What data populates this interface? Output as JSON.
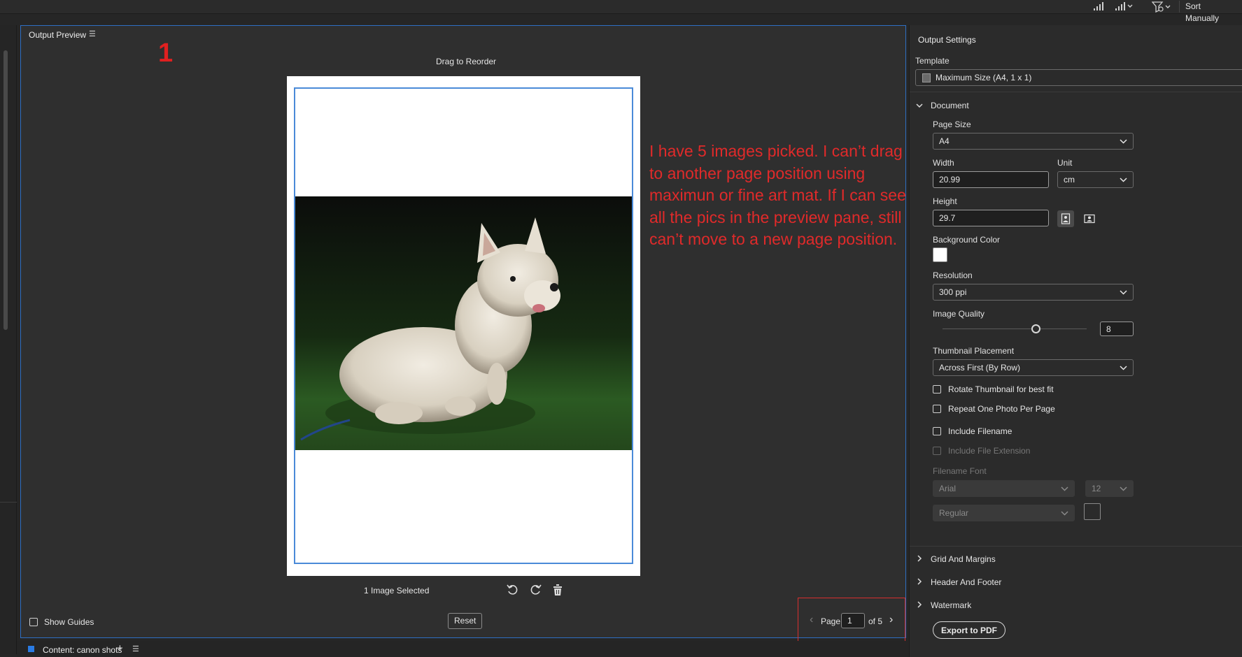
{
  "toolbar": {
    "sort_label": "Sort Manually",
    "icons": [
      "sort-ascending-icon",
      "sort-descending-icon",
      "filter-icon"
    ]
  },
  "preview": {
    "title": "Output Preview",
    "annotation_number": "1",
    "drag_label": "Drag to Reorder",
    "annotation_text": "I have 5 images picked. I can’t drag to another page position using maximun or fine art mat. If I can see all the pics in the preview pane, still can’t move to a new page position.",
    "selection_label": "1 Image Selected",
    "show_guides_label": "Show Guides",
    "reset_label": "Reset",
    "pager": {
      "page_label": "Page",
      "current_page": "1",
      "of_label": "of 5"
    }
  },
  "content_bar": {
    "title": "Content: canon shots"
  },
  "settings": {
    "title": "Output Settings",
    "template_label": "Template",
    "template_value": "Maximum Size (A4, 1 x 1)",
    "document_section": "Document",
    "page_size_label": "Page Size",
    "page_size_value": "A4",
    "width_label": "Width",
    "width_value": "20.99",
    "unit_label": "Unit",
    "unit_value": "cm",
    "height_label": "Height",
    "height_value": "29.7",
    "background_color_label": "Background Color",
    "background_color": "#ffffff",
    "resolution_label": "Resolution",
    "resolution_value": "300 ppi",
    "image_quality_label": "Image Quality",
    "image_quality_value": "8",
    "image_quality_level": 0.65,
    "thumbnail_placement_label": "Thumbnail Placement",
    "thumbnail_placement_value": "Across First (By Row)",
    "checkboxes": {
      "rotate": "Rotate Thumbnail for best fit",
      "repeat": "Repeat One Photo Per Page",
      "include_filename": "Include Filename",
      "include_extension": "Include File Extension"
    },
    "filename_font_label": "Filename Font",
    "font_family_value": "Arial",
    "font_size_value": "12",
    "font_style_value": "Regular",
    "sections": {
      "grid": "Grid And Margins",
      "header": "Header And Footer",
      "watermark": "Watermark"
    },
    "export_label": "Export to PDF"
  },
  "colors": {
    "accent_blue": "#2e6fc4",
    "annotation_red": "#e02020",
    "panel_bg": "#2f2f2f"
  }
}
